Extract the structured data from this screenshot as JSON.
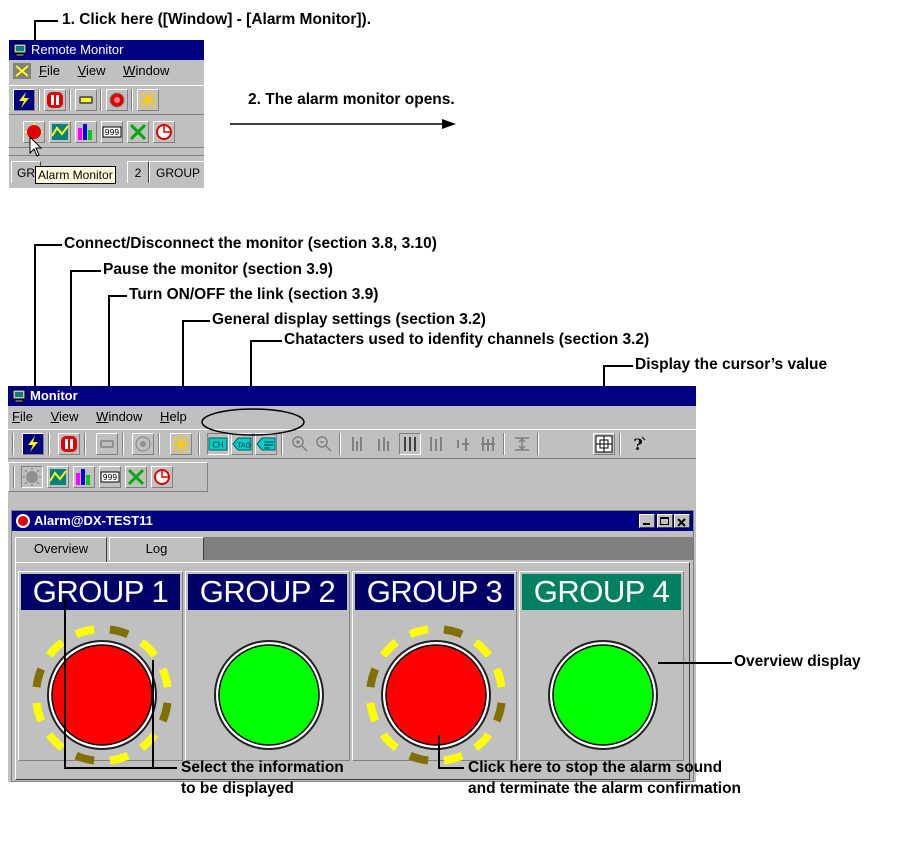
{
  "annotations": {
    "step1": "1. Click here ([Window] - [Alarm Monitor]).",
    "step2": "2. The alarm monitor opens.",
    "connect": "Connect/Disconnect the monitor (section 3.8, 3.10)",
    "pause": "Pause the monitor (section 3.9)",
    "link": "Turn ON/OFF the link (section 3.9)",
    "general": "General display settings (section 3.2)",
    "characters": "Chatacters used to idenfity channels (section 3.2)",
    "cursor": "Display the cursor’s value",
    "overview_display": "Overview display",
    "select_line1": "Select the information",
    "select_line2": "to be displayed",
    "stop_line1": "Click here to stop the alarm sound",
    "stop_line2": "and terminate the alarm confirmation"
  },
  "remote_monitor": {
    "title": "Remote Monitor",
    "menu": [
      "File",
      "View",
      "Window"
    ],
    "tooltip": "Alarm Monitor",
    "tabs": [
      "GR",
      "2",
      "GROUP"
    ]
  },
  "monitor": {
    "title": "Monitor",
    "menu": [
      "File",
      "View",
      "Window",
      "Help"
    ],
    "toolbar_icons": [
      "connect-icon",
      "pause-icon",
      "link-icon",
      "record-icon",
      "general-settings-icon",
      "channel-number-icon",
      "tag-icon",
      "tag-comment-icon",
      "zoom-in-icon",
      "zoom-out-icon",
      "trend-icon-1",
      "trend-icon-2",
      "trend-icon-3",
      "trend-icon-4",
      "trend-icon-5",
      "trend-icon-6",
      "range-icon",
      "cursor-value-icon",
      "help-icon"
    ],
    "toolbar2_icons": [
      "alarm-monitor-icon",
      "trend-window-icon",
      "bar-window-icon",
      "digital-window-icon",
      "overview-window-icon",
      "circular-window-icon"
    ]
  },
  "alarm_window": {
    "title": "Alarm@DX-TEST11",
    "tabs": [
      "Overview",
      "Log"
    ],
    "active_tab": "Overview",
    "groups": [
      {
        "label": "GROUP 1",
        "status": "alarm",
        "header_color": "#000066",
        "lamp_color": "#ff0000"
      },
      {
        "label": "GROUP 2",
        "status": "normal",
        "header_color": "#000066",
        "lamp_color": "#00ff00"
      },
      {
        "label": "GROUP 3",
        "status": "alarm",
        "header_color": "#000066",
        "lamp_color": "#ff0000"
      },
      {
        "label": "GROUP 4",
        "status": "normal",
        "header_color": "#008060",
        "lamp_color": "#00ff00"
      }
    ]
  }
}
